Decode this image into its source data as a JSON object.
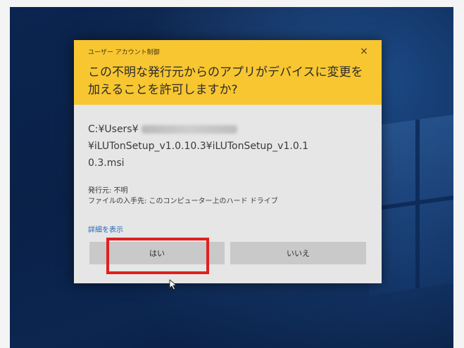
{
  "dialog": {
    "caption": "ユーザー アカウント制御",
    "close_label": "×",
    "question": "この不明な発行元からのアプリがデバイスに変更を加えることを許可しますか?",
    "path_lines": [
      "C:¥Users¥",
      "¥iLUTonSetup_v1.0.10.3¥iLUTonSetup_v1.0.1",
      "0.3.msi"
    ],
    "publisher": "発行元: 不明",
    "source": "ファイルの入手先: このコンピューター上のハード ドライブ",
    "details_link": "詳細を表示",
    "yes_label": "はい",
    "no_label": "いいえ"
  },
  "colors": {
    "header": "#f7c630",
    "body": "#e6e6e6",
    "button": "#c9c9c9",
    "highlight": "#e02020",
    "link": "#2a68b6"
  },
  "icons": {
    "close": "close-icon",
    "cursor": "mouse-pointer-icon"
  }
}
